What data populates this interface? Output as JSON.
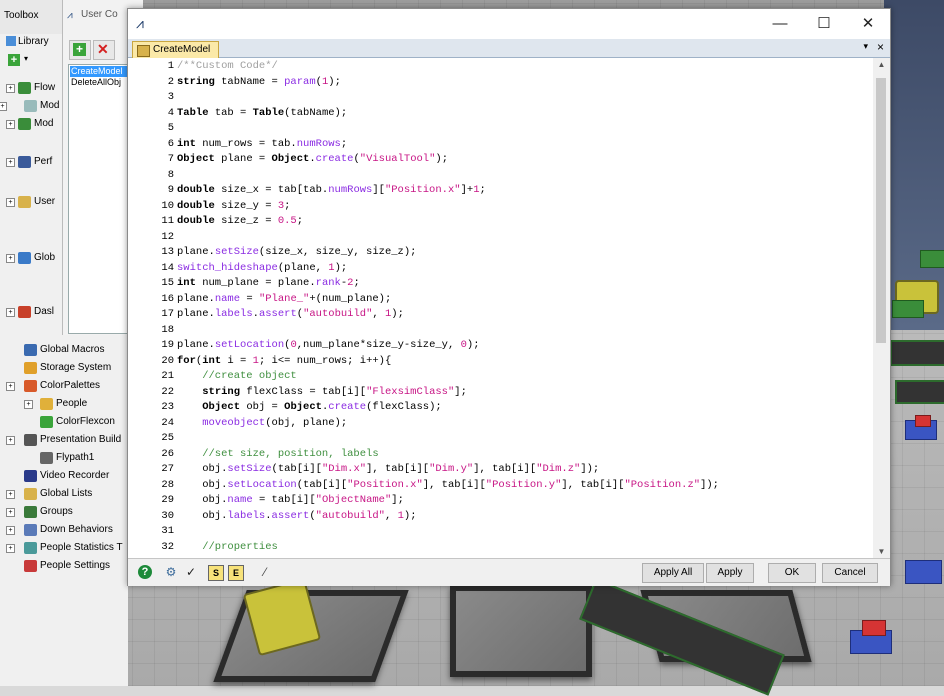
{
  "toolbox": {
    "tab_toolbox": "Toolbox",
    "tab_usercode": "User Co",
    "library_label": "Library",
    "tree_items": [
      {
        "label": "Flow",
        "y": 0
      },
      {
        "label": "Mod",
        "y": 0
      },
      {
        "label": "Mod",
        "y": 0
      },
      {
        "label": "Perf",
        "y": 0
      },
      {
        "label": "User",
        "y": 0
      },
      {
        "label": "Glob",
        "y": 0
      },
      {
        "label": "Dasl",
        "y": 0
      },
      {
        "label": "Global Macros"
      },
      {
        "label": "Storage System"
      },
      {
        "label": "ColorPalettes"
      },
      {
        "label": "People"
      },
      {
        "label": "ColorFlexcon"
      },
      {
        "label": "Presentation Build"
      },
      {
        "label": "Flypath1"
      },
      {
        "label": "Video Recorder"
      },
      {
        "label": "Global Lists"
      },
      {
        "label": "Groups"
      },
      {
        "label": "Down Behaviors"
      },
      {
        "label": "People Statistics T"
      },
      {
        "label": "People Settings"
      }
    ]
  },
  "usercode_list": {
    "items": [
      {
        "label": "CreateModel",
        "selected": true
      },
      {
        "label": "DeleteAllObj",
        "selected": false
      }
    ]
  },
  "editor_window": {
    "title_icon": "flexsim-icon",
    "minimize": "—",
    "maximize": "☐",
    "close": "✕",
    "tab_label": "CreateModel",
    "tab_menu": "▾",
    "tab_close": "×"
  },
  "code_lines": [
    {
      "n": "1",
      "t": "/**Custom Code*/"
    },
    {
      "n": "2",
      "t": "string tabName = param(1);"
    },
    {
      "n": "3",
      "t": ""
    },
    {
      "n": "4",
      "t": "Table tab = Table(tabName);"
    },
    {
      "n": "5",
      "t": ""
    },
    {
      "n": "6",
      "t": "int num_rows = tab.numRows;"
    },
    {
      "n": "7",
      "t": "Object plane = Object.create(\"VisualTool\");"
    },
    {
      "n": "8",
      "t": ""
    },
    {
      "n": "9",
      "t": "double size_x = tab[tab.numRows][\"Position.x\"]+1;"
    },
    {
      "n": "10",
      "t": "double size_y = 3;"
    },
    {
      "n": "11",
      "t": "double size_z = 0.5;"
    },
    {
      "n": "12",
      "t": ""
    },
    {
      "n": "13",
      "t": "plane.setSize(size_x, size_y, size_z);"
    },
    {
      "n": "14",
      "t": "switch_hideshape(plane, 1);"
    },
    {
      "n": "15",
      "t": "int num_plane = plane.rank-2;"
    },
    {
      "n": "16",
      "t": "plane.name = \"Plane_\"+(num_plane);"
    },
    {
      "n": "17",
      "t": "plane.labels.assert(\"autobuild\", 1);"
    },
    {
      "n": "18",
      "t": ""
    },
    {
      "n": "19",
      "t": "plane.setLocation(0,num_plane*size_y-size_y, 0);"
    },
    {
      "n": "20",
      "t": "for(int i = 1; i<= num_rows; i++){"
    },
    {
      "n": "21",
      "t": "    //create object"
    },
    {
      "n": "22",
      "t": "    string flexClass = tab[i][\"FlexsimClass\"];"
    },
    {
      "n": "23",
      "t": "    Object obj = Object.create(flexClass);"
    },
    {
      "n": "24",
      "t": "    moveobject(obj, plane);"
    },
    {
      "n": "25",
      "t": ""
    },
    {
      "n": "26",
      "t": "    //set size, position, labels"
    },
    {
      "n": "27",
      "t": "    obj.setSize(tab[i][\"Dim.x\"], tab[i][\"Dim.y\"], tab[i][\"Dim.z\"]);"
    },
    {
      "n": "28",
      "t": "    obj.setLocation(tab[i][\"Position.x\"], tab[i][\"Position.y\"], tab[i][\"Position.z\"]);"
    },
    {
      "n": "29",
      "t": "    obj.name = tab[i][\"ObjectName\"];"
    },
    {
      "n": "30",
      "t": "    obj.labels.assert(\"autobuild\", 1);"
    },
    {
      "n": "31",
      "t": ""
    },
    {
      "n": "32",
      "t": "    //properties"
    }
  ],
  "bottom": {
    "apply_all": "Apply All",
    "apply": "Apply",
    "ok": "OK",
    "cancel": "Cancel",
    "icons": [
      "help-icon",
      "add-code-icon",
      "check-syntax-icon",
      "s-icon",
      "e-icon",
      "pick-icon"
    ]
  }
}
